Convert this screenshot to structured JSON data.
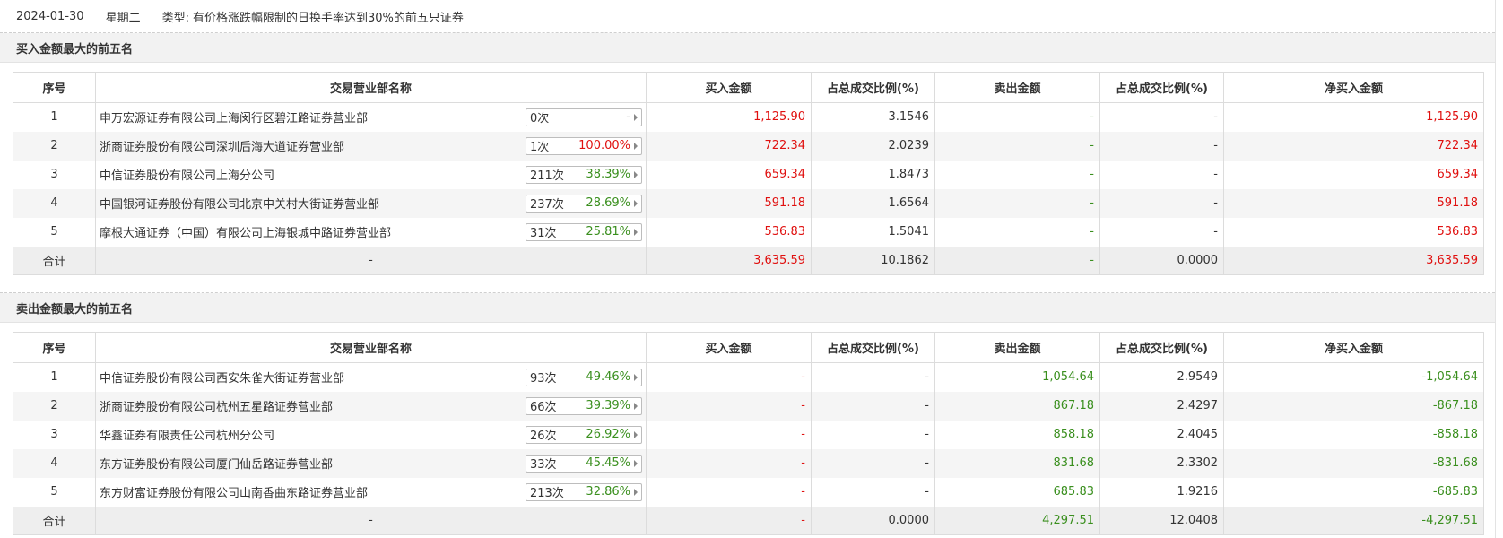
{
  "header": {
    "date": "2024-01-30",
    "weekday": "星期二",
    "type_label": "类型:",
    "type_value": "有价格涨跌幅限制的日换手率达到30%的前五只证券"
  },
  "columns": [
    "序号",
    "交易营业部名称",
    "买入金额",
    "占总成交比例(%)",
    "卖出金额",
    "占总成交比例(%)",
    "净买入金额"
  ],
  "buy_section": {
    "title": "买入金额最大的前五名",
    "rows": [
      {
        "idx": "1",
        "name": "申万宏源证券有限公司上海闵行区碧江路证券营业部",
        "count": "0次",
        "rate": "-",
        "buy": "1,125.90",
        "buy_pct": "3.1546",
        "sell": "-",
        "sell_pct": "-",
        "net": "1,125.90"
      },
      {
        "idx": "2",
        "name": "浙商证券股份有限公司深圳后海大道证券营业部",
        "count": "1次",
        "rate": "100.00%",
        "buy": "722.34",
        "buy_pct": "2.0239",
        "sell": "-",
        "sell_pct": "-",
        "net": "722.34"
      },
      {
        "idx": "3",
        "name": "中信证券股份有限公司上海分公司",
        "count": "211次",
        "rate": "38.39%",
        "buy": "659.34",
        "buy_pct": "1.8473",
        "sell": "-",
        "sell_pct": "-",
        "net": "659.34"
      },
      {
        "idx": "4",
        "name": "中国银河证券股份有限公司北京中关村大街证券营业部",
        "count": "237次",
        "rate": "28.69%",
        "buy": "591.18",
        "buy_pct": "1.6564",
        "sell": "-",
        "sell_pct": "-",
        "net": "591.18"
      },
      {
        "idx": "5",
        "name": "摩根大通证券（中国）有限公司上海银城中路证券营业部",
        "count": "31次",
        "rate": "25.81%",
        "buy": "536.83",
        "buy_pct": "1.5041",
        "sell": "-",
        "sell_pct": "-",
        "net": "536.83"
      }
    ],
    "total": {
      "label": "合计",
      "name": "-",
      "buy": "3,635.59",
      "buy_pct": "10.1862",
      "sell": "-",
      "sell_pct": "0.0000",
      "net": "3,635.59"
    }
  },
  "sell_section": {
    "title": "卖出金额最大的前五名",
    "rows": [
      {
        "idx": "1",
        "name": "中信证券股份有限公司西安朱雀大街证券营业部",
        "count": "93次",
        "rate": "49.46%",
        "buy": "-",
        "buy_pct": "-",
        "sell": "1,054.64",
        "sell_pct": "2.9549",
        "net": "-1,054.64"
      },
      {
        "idx": "2",
        "name": "浙商证券股份有限公司杭州五星路证券营业部",
        "count": "66次",
        "rate": "39.39%",
        "buy": "-",
        "buy_pct": "-",
        "sell": "867.18",
        "sell_pct": "2.4297",
        "net": "-867.18"
      },
      {
        "idx": "3",
        "name": "华鑫证券有限责任公司杭州分公司",
        "count": "26次",
        "rate": "26.92%",
        "buy": "-",
        "buy_pct": "-",
        "sell": "858.18",
        "sell_pct": "2.4045",
        "net": "-858.18"
      },
      {
        "idx": "4",
        "name": "东方证券股份有限公司厦门仙岳路证券营业部",
        "count": "33次",
        "rate": "45.45%",
        "buy": "-",
        "buy_pct": "-",
        "sell": "831.68",
        "sell_pct": "2.3302",
        "net": "-831.68"
      },
      {
        "idx": "5",
        "name": "东方财富证券股份有限公司山南香曲东路证券营业部",
        "count": "213次",
        "rate": "32.86%",
        "buy": "-",
        "buy_pct": "-",
        "sell": "685.83",
        "sell_pct": "1.9216",
        "net": "-685.83"
      }
    ],
    "total": {
      "label": "合计",
      "name": "-",
      "buy": "-",
      "buy_pct": "0.0000",
      "sell": "4,297.51",
      "sell_pct": "12.0408",
      "net": "-4,297.51"
    }
  },
  "colors": {
    "up": "#e0100f",
    "down": "#3a8f1e"
  }
}
